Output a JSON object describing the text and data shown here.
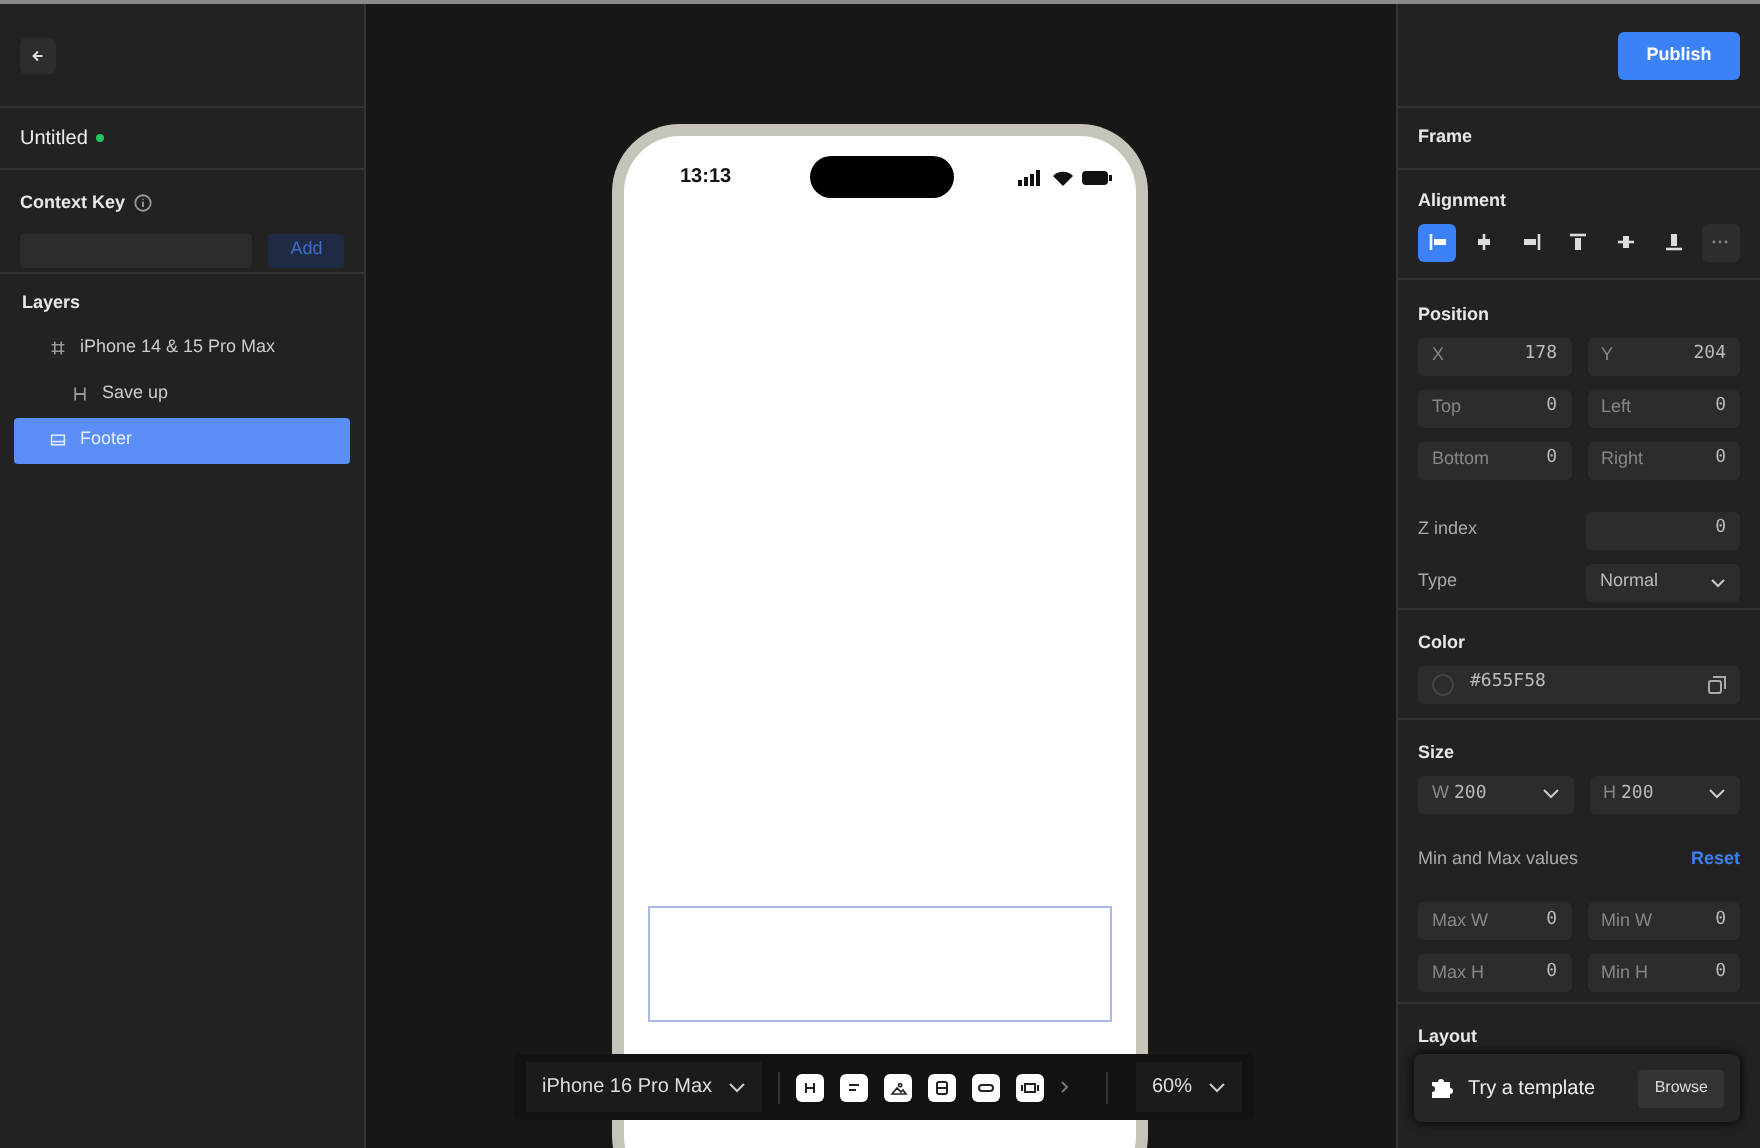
{
  "left_panel": {
    "project": {
      "title": "Untitled",
      "saved": true
    },
    "context_key": {
      "label": "Context Key",
      "button": "Add"
    },
    "layers": {
      "title": "Layers",
      "items": [
        {
          "label": "iPhone 14 & 15 Pro Max",
          "kind": "frame",
          "selected": false,
          "children": [
            {
              "label": "Save up",
              "kind": "heading",
              "selected": false
            }
          ]
        },
        {
          "label": "Footer",
          "kind": "footer",
          "selected": true
        }
      ]
    }
  },
  "canvas": {
    "phone": {
      "time": "13:13"
    },
    "toolbar": {
      "device": "iPhone 16 Pro Max",
      "tools": [
        {
          "kind": "heading"
        },
        {
          "kind": "text"
        },
        {
          "kind": "image"
        },
        {
          "kind": "stack"
        },
        {
          "kind": "button"
        },
        {
          "kind": "card"
        }
      ],
      "zoom": "60%"
    }
  },
  "right_panel": {
    "publish": "Publish",
    "frame": "Frame",
    "alignment": {
      "title": "Alignment",
      "buttons": [
        {
          "kind": "left",
          "selected": true
        },
        {
          "kind": "center-h",
          "selected": false
        },
        {
          "kind": "right",
          "selected": false
        },
        {
          "kind": "top",
          "selected": false
        },
        {
          "kind": "center-v",
          "selected": false
        },
        {
          "kind": "bottom",
          "selected": false
        },
        {
          "kind": "more",
          "selected": false
        }
      ]
    },
    "position": {
      "title": "Position",
      "fields": [
        {
          "label": "X",
          "value": "178"
        },
        {
          "label": "Y",
          "value": "204"
        },
        {
          "label": "Top",
          "value": "0"
        },
        {
          "label": "Left",
          "value": "0"
        },
        {
          "label": "Bottom",
          "value": "0"
        },
        {
          "label": "Right",
          "value": "0"
        }
      ],
      "z_index": {
        "label": "Z index",
        "value": "0"
      },
      "type": {
        "label": "Type",
        "value": "Normal"
      }
    },
    "color": {
      "title": "Color",
      "value": "#655F58"
    },
    "size": {
      "title": "Size",
      "width": {
        "label": "W",
        "value": "200"
      },
      "height": {
        "label": "H",
        "value": "200"
      },
      "min_max": {
        "label": "Min and Max values",
        "reset": "Reset",
        "fields": [
          {
            "label": "Max W",
            "value": "0"
          },
          {
            "label": "Min W",
            "value": "0"
          },
          {
            "label": "Max H",
            "value": "0"
          },
          {
            "label": "Min H",
            "value": "0"
          }
        ]
      }
    },
    "layout": {
      "title": "Layout"
    },
    "template_popup": {
      "text": "Try a template",
      "button": "Browse"
    }
  }
}
